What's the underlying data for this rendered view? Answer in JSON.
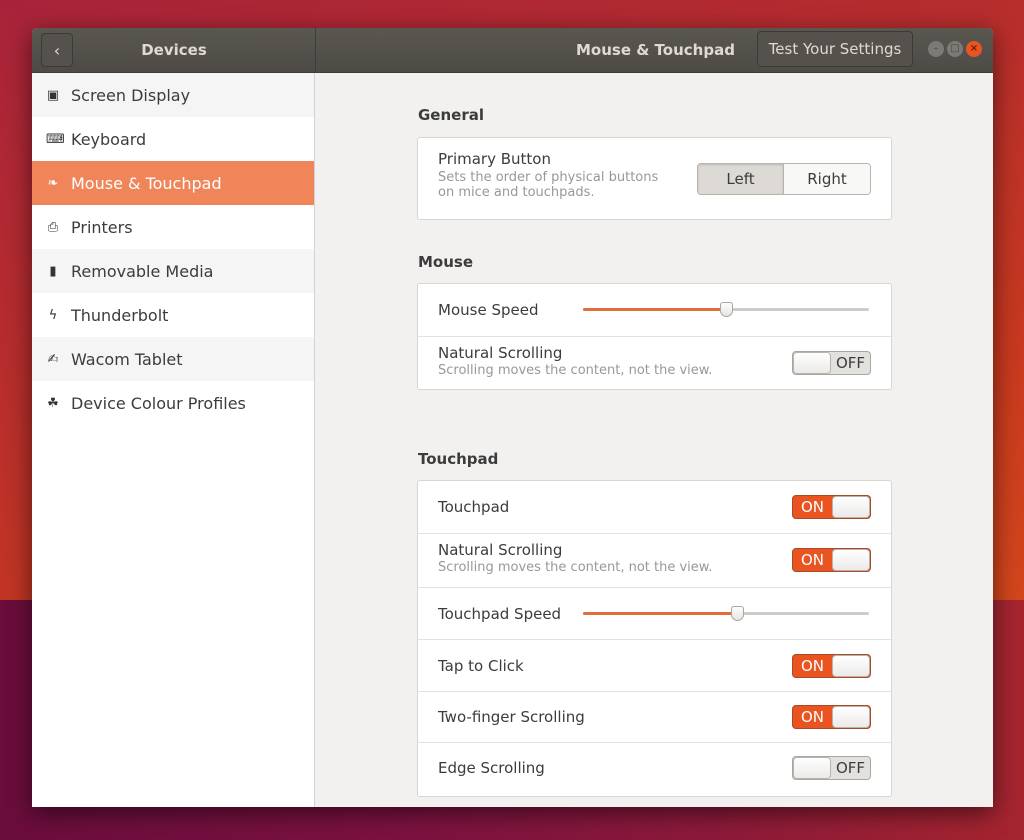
{
  "window": {
    "sidebar_title": "Devices",
    "panel_title": "Mouse & Touchpad",
    "test_button": "Test Your Settings",
    "back_icon": "chevron-left-icon",
    "controls": [
      "minimize",
      "maximize",
      "close"
    ]
  },
  "sidebar": {
    "items": [
      {
        "label": "Screen Display",
        "icon": "display-icon",
        "active": false
      },
      {
        "label": "Keyboard",
        "icon": "keyboard-icon",
        "active": false
      },
      {
        "label": "Mouse & Touchpad",
        "icon": "mouse-icon",
        "active": true
      },
      {
        "label": "Printers",
        "icon": "printer-icon",
        "active": false
      },
      {
        "label": "Removable Media",
        "icon": "usb-drive-icon",
        "active": false
      },
      {
        "label": "Thunderbolt",
        "icon": "thunderbolt-icon",
        "active": false
      },
      {
        "label": "Wacom Tablet",
        "icon": "tablet-icon",
        "active": false
      },
      {
        "label": "Device Colour Profiles",
        "icon": "colour-profile-icon",
        "active": false
      }
    ]
  },
  "general": {
    "title": "General",
    "primary_button": {
      "label": "Primary Button",
      "description_line1": "Sets the order of physical buttons",
      "description_line2": "on mice and touchpads.",
      "options": [
        "Left",
        "Right"
      ],
      "selected": "Left"
    }
  },
  "mouse": {
    "title": "Mouse",
    "speed": {
      "label": "Mouse Speed",
      "value": 0.5
    },
    "natural_scrolling": {
      "label": "Natural Scrolling",
      "description": "Scrolling moves the content, not the view.",
      "state": "OFF"
    }
  },
  "touchpad": {
    "title": "Touchpad",
    "touchpad": {
      "label": "Touchpad",
      "state": "ON"
    },
    "natural_scrolling": {
      "label": "Natural Scrolling",
      "description": "Scrolling moves the content, not the view.",
      "state": "ON"
    },
    "speed": {
      "label": "Touchpad Speed",
      "value": 0.54
    },
    "tap_to_click": {
      "label": "Tap to Click",
      "state": "ON"
    },
    "two_finger": {
      "label": "Two-finger Scrolling",
      "state": "ON"
    },
    "edge": {
      "label": "Edge Scrolling",
      "state": "OFF"
    }
  },
  "colors": {
    "accent": "#e95420",
    "sidebar_active": "#f0855a"
  }
}
